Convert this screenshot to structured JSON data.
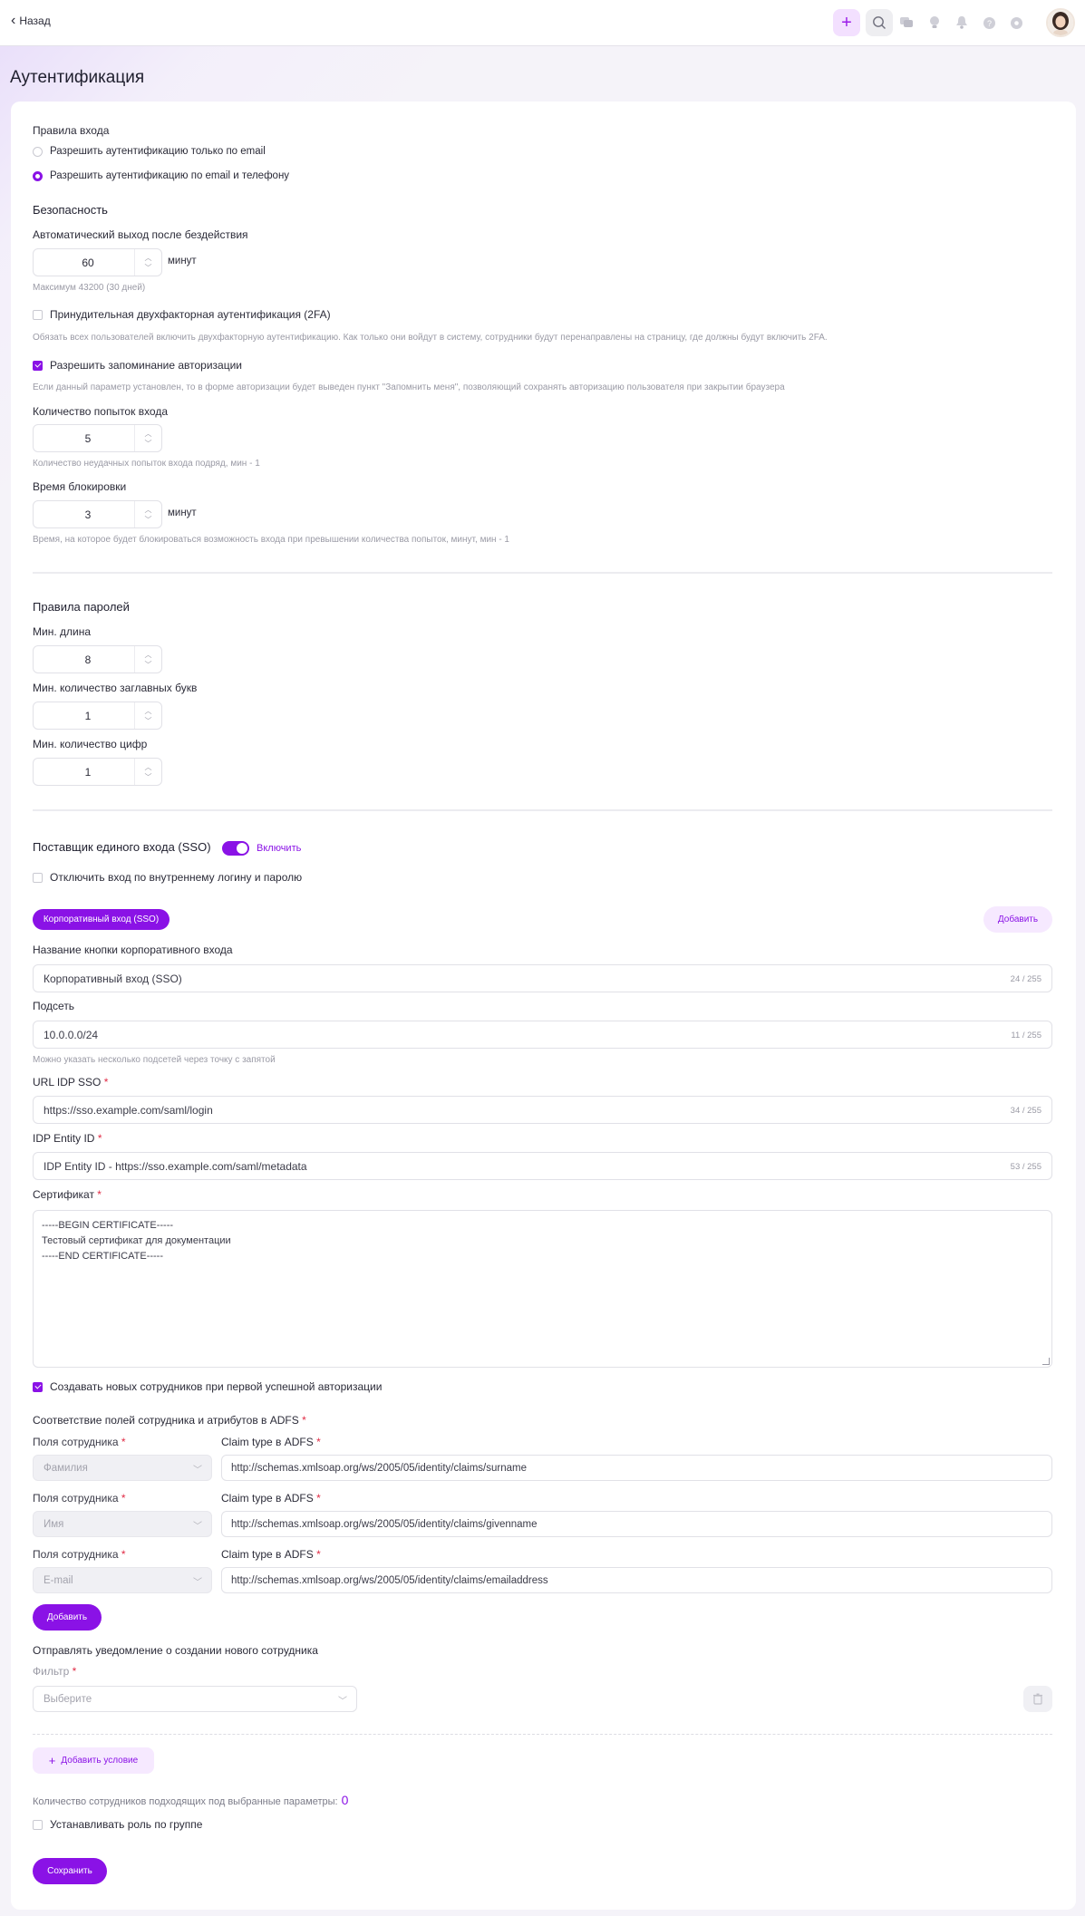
{
  "topbar": {
    "back_label": "Назад"
  },
  "page_title": "Аутентификация",
  "login_rules": {
    "title": "Правила входа",
    "options": [
      "Разрешить аутентификацию только по email",
      "Разрешить аутентификацию по email и телефону"
    ],
    "selected_index": 1
  },
  "security": {
    "title": "Безопасность",
    "auto_logout": {
      "label": "Автоматический выход после бездействия",
      "value": "60",
      "unit": "минут",
      "hint": "Максимум 43200 (30 дней)"
    },
    "force_2fa": {
      "label": "Принудительная двухфакторная аутентификация (2FA)",
      "checked": false,
      "hint": "Обязать всех пользователей включить двухфакторную аутентификацию. Как только они войдут в систему, сотрудники будут перенаправлены на страницу, где должны будут включить 2FA."
    },
    "remember": {
      "label": "Разрешить запоминание авторизации",
      "checked": true,
      "hint": "Если данный параметр установлен, то в форме авторизации будет выведен пункт \"Запомнить меня\", позволяющий сохранять авторизацию пользователя при закрытии браузера"
    },
    "attempts": {
      "label": "Количество попыток входа",
      "value": "5",
      "hint": "Количество неудачных попыток входа подряд, мин - 1"
    },
    "lock_time": {
      "label": "Время блокировки",
      "value": "3",
      "unit": "минут",
      "hint": "Время, на которое будет блокироваться возможность входа при превышении количества попыток, минут, мин - 1"
    }
  },
  "password_rules": {
    "title": "Правила паролей",
    "min_length": {
      "label": "Мин. длина",
      "value": "8"
    },
    "min_upper": {
      "label": "Мин. количество заглавных букв",
      "value": "1"
    },
    "min_digits": {
      "label": "Мин. количество цифр",
      "value": "1"
    }
  },
  "sso": {
    "title": "Поставщик единого входа (SSO)",
    "toggle_label": "Включить",
    "enabled": true,
    "disable_internal": {
      "label": "Отключить вход по внутреннему логину и паролю",
      "checked": false
    },
    "tab_label": "Корпоративный вход (SSO)",
    "add_label": "Добавить",
    "button_name": {
      "label": "Название кнопки корпоративного входа",
      "value": "Корпоративный вход (SSO)",
      "counter": "24 / 255"
    },
    "subnet": {
      "label": "Подсеть",
      "value": "10.0.0.0/24",
      "counter": "11 / 255",
      "hint": "Можно указать несколько подсетей через точку с запятой"
    },
    "idp_url": {
      "label": "URL IDP SSO",
      "required": "*",
      "value": "https://sso.example.com/saml/login",
      "counter": "34 / 255"
    },
    "idp_entity": {
      "label": "IDP Entity ID",
      "required": "*",
      "value": "IDP Entity ID - https://sso.example.com/saml/metadata",
      "counter": "53 / 255"
    },
    "certificate": {
      "label": "Сертификат",
      "required": "*",
      "lines": [
        "-----BEGIN CERTIFICATE-----",
        "Тестовый сертификат для документации",
        "-----END CERTIFICATE-----"
      ]
    },
    "create_employees": {
      "label": "Создавать новых сотрудников при первой успешной авторизации",
      "checked": true
    },
    "mapping": {
      "title": "Соответствие полей сотрудника и атрибутов в ADFS",
      "required": "*",
      "field_label": "Поля сотрудника",
      "claim_label": "Claim type в ADFS",
      "rows": [
        {
          "field": "Фамилия",
          "claim": "http://schemas.xmlsoap.org/ws/2005/05/identity/claims/surname"
        },
        {
          "field": "Имя",
          "claim": "http://schemas.xmlsoap.org/ws/2005/05/identity/claims/givenname"
        },
        {
          "field": "E-mail",
          "claim": "http://schemas.xmlsoap.org/ws/2005/05/identity/claims/emailaddress"
        }
      ],
      "add_label": "Добавить"
    },
    "notify": {
      "label": "Отправлять уведомление о создании нового сотрудника"
    },
    "filter": {
      "label": "Фильтр",
      "required": "*",
      "placeholder": "Выберите"
    },
    "add_condition": "Добавить условие",
    "count": {
      "label": "Количество сотрудников подходящих под выбранные параметры:",
      "value": "0"
    },
    "role_by_group": {
      "label": "Устанавливать роль по группе",
      "checked": false
    }
  },
  "save_label": "Сохранить",
  "colors": {
    "accent": "#8a12e6",
    "accent_soft": "#f6e9ff",
    "required": "#e02a44"
  },
  "icons": [
    "chevron-left-icon",
    "plus-icon",
    "search-icon",
    "chat-icon",
    "lightbulb-icon",
    "bell-icon",
    "help-icon",
    "settings-icon",
    "avatar",
    "chevron-down-icon",
    "trash-icon"
  ]
}
